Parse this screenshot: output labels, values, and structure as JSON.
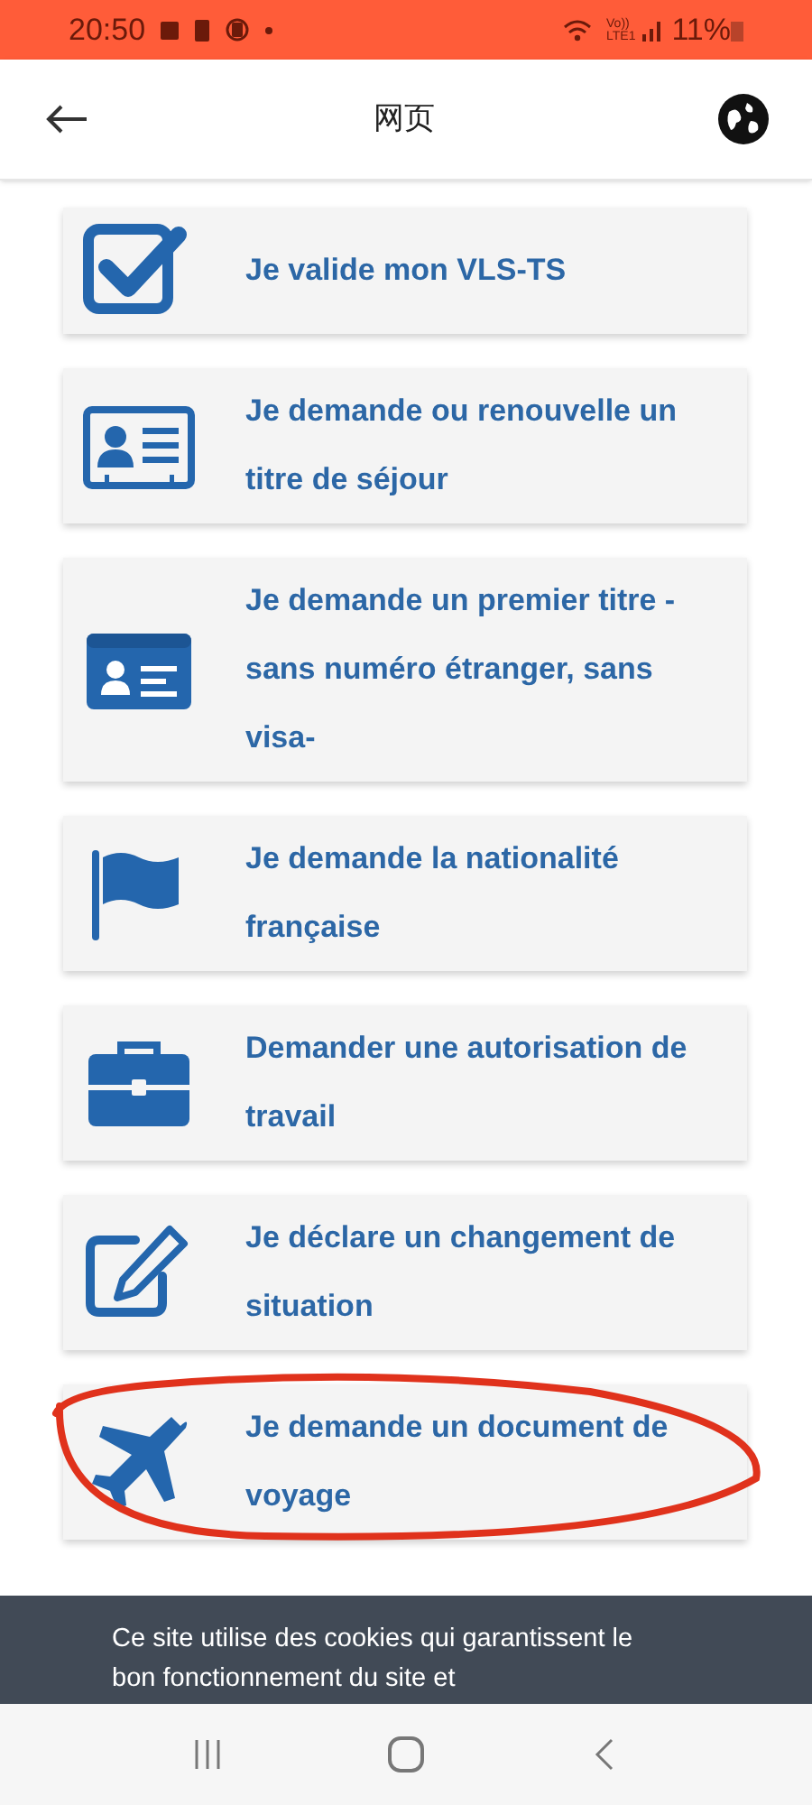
{
  "status_bar": {
    "time": "20:50",
    "network_top": "Vo))",
    "network_bottom": "LTE1",
    "battery": "11%"
  },
  "header": {
    "title": "网页"
  },
  "items": [
    {
      "kind": "check",
      "lines": [
        "Je valide mon VLS-TS"
      ]
    },
    {
      "kind": "id-card",
      "lines": [
        "Je demande ou renouvelle un",
        "titre de séjour"
      ]
    },
    {
      "kind": "id-card-filled",
      "lines": [
        "Je demande un premier titre -",
        "sans numéro étranger, sans",
        "visa-"
      ]
    },
    {
      "kind": "flag",
      "lines": [
        "Je demande la nationalité",
        "française"
      ]
    },
    {
      "kind": "briefcase",
      "lines": [
        "Demander une autorisation de",
        "travail"
      ]
    },
    {
      "kind": "edit",
      "lines": [
        "Je déclare un changement de",
        "situation"
      ]
    },
    {
      "kind": "plane",
      "lines": [
        "Je demande un document de",
        "voyage"
      ],
      "circled": true
    }
  ],
  "cookie_banner": {
    "text": "Ce site utilise des cookies qui garantissent le bon fonctionnement du site et"
  }
}
